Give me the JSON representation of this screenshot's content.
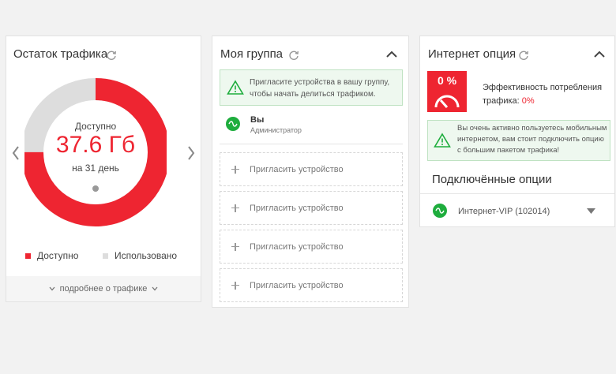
{
  "traffic": {
    "title": "Остаток трафика",
    "available_label": "Доступно",
    "amount": "37.6 Гб",
    "period": "на 31 день",
    "legend_available": "Доступно",
    "legend_used": "Использовано",
    "more_link": "подробнее о трафике",
    "available_fraction": 0.75,
    "colors": {
      "available": "#ee2531",
      "used": "#dddddd"
    }
  },
  "group": {
    "title": "Моя группа",
    "notice": "Пригласите устройства в вашу группу, чтобы начать делиться трафиком.",
    "member_name": "Вы",
    "member_role": "Администратор",
    "invites": [
      "Пригласить устройство",
      "Пригласить устройство",
      "Пригласить устройство",
      "Пригласить устройство"
    ]
  },
  "internet": {
    "title": "Интернет опция",
    "percent_badge": "0 %",
    "efficiency_label": "Эффективность потребления трафика:",
    "efficiency_value": "0%",
    "notice": "Вы очень активно пользуетесь мобильным интернетом, вам стоит подключить опцию с большим пакетом трафика!",
    "connected_title": "Подключённые опции",
    "option_name": "Интернет-VIP (102014)"
  }
}
